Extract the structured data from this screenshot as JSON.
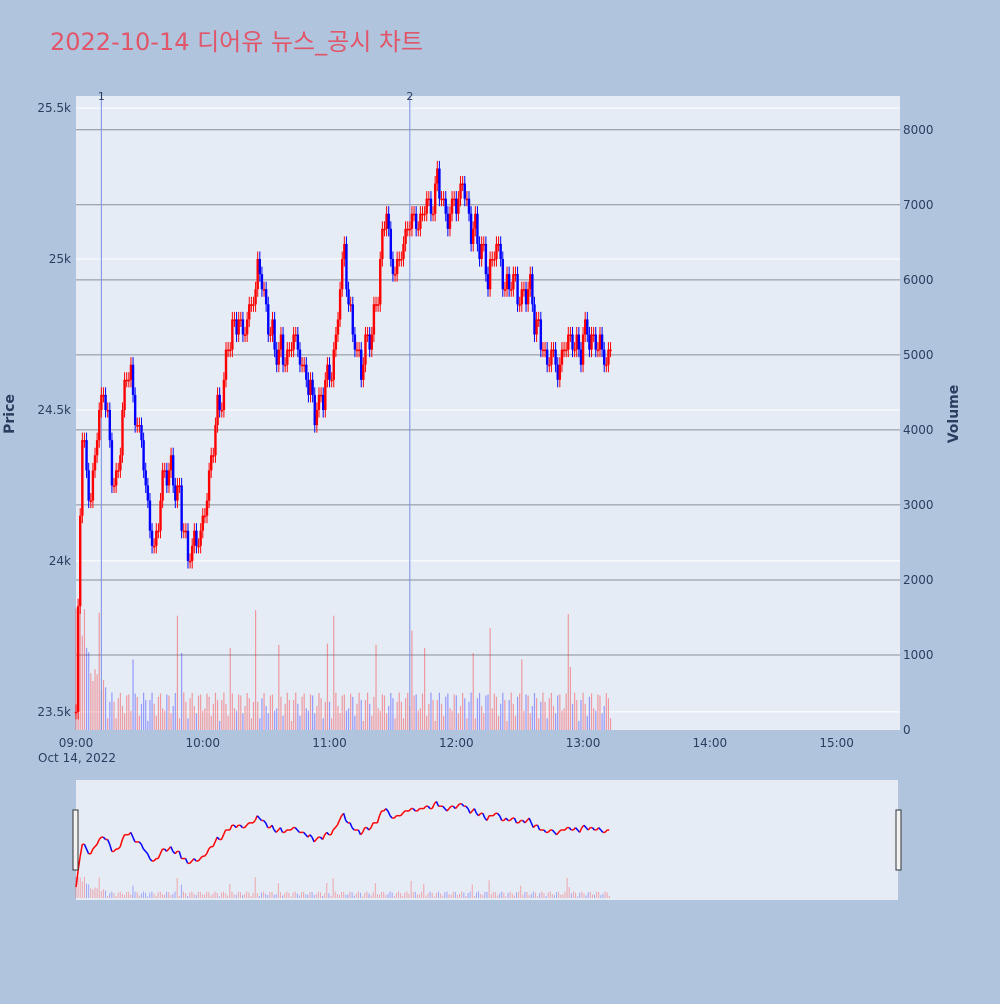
{
  "page": {
    "title": "2022-10-14 디어유 뉴스_공시 차트",
    "title_color": "#e0566a",
    "background": "#b0c4de",
    "plot_background": "#e5ecf6"
  },
  "chart_data": {
    "type": "candlestick",
    "title": "2022-10-14 디어유 뉴스_공시 차트",
    "date_label": "Oct 14, 2022",
    "x_ticks": [
      "09:00",
      "10:00",
      "11:00",
      "12:00",
      "13:00",
      "14:00",
      "15:00"
    ],
    "x_range": [
      "09:00",
      "15:30"
    ],
    "price_axis": {
      "label": "Price",
      "ticks": [
        23500,
        24000,
        24500,
        25000,
        25500
      ],
      "tick_labels": [
        "23.5k",
        "24k",
        "24.5k",
        "25k",
        "25.5k"
      ],
      "range": [
        23440,
        25540
      ]
    },
    "volume_axis": {
      "label": "Volume",
      "ticks": [
        0,
        1000,
        2000,
        3000,
        4000,
        5000,
        6000,
        7000,
        8000
      ],
      "range": [
        0,
        8450
      ]
    },
    "colors": {
      "up": "#ff0000",
      "down": "#0000ff"
    },
    "price_path": [
      [
        "09:00",
        23500
      ],
      [
        "09:01",
        23850
      ],
      [
        "09:02",
        24200
      ],
      [
        "09:03",
        24400
      ],
      [
        "09:05",
        24300
      ],
      [
        "09:07",
        24200
      ],
      [
        "09:09",
        24350
      ],
      [
        "09:11",
        24500
      ],
      [
        "09:13",
        24550
      ],
      [
        "09:15",
        24450
      ],
      [
        "09:17",
        24300
      ],
      [
        "09:19",
        24250
      ],
      [
        "09:21",
        24400
      ],
      [
        "09:23",
        24550
      ],
      [
        "09:25",
        24650
      ],
      [
        "09:27",
        24550
      ],
      [
        "09:29",
        24450
      ],
      [
        "09:31",
        24400
      ],
      [
        "09:33",
        24250
      ],
      [
        "09:35",
        24100
      ],
      [
        "09:37",
        24050
      ],
      [
        "09:39",
        24150
      ],
      [
        "09:41",
        24250
      ],
      [
        "09:43",
        24300
      ],
      [
        "09:45",
        24300
      ],
      [
        "09:47",
        24250
      ],
      [
        "09:49",
        24200
      ],
      [
        "09:51",
        24100
      ],
      [
        "09:53",
        24000
      ],
      [
        "09:55",
        24050
      ],
      [
        "09:57",
        24050
      ],
      [
        "09:59",
        24100
      ],
      [
        "10:01",
        24150
      ],
      [
        "10:03",
        24250
      ],
      [
        "10:05",
        24400
      ],
      [
        "10:07",
        24500
      ],
      [
        "10:09",
        24550
      ],
      [
        "10:11",
        24650
      ],
      [
        "10:13",
        24750
      ],
      [
        "10:15",
        24800
      ],
      [
        "10:17",
        24800
      ],
      [
        "10:19",
        24750
      ],
      [
        "10:21",
        24800
      ],
      [
        "10:23",
        24850
      ],
      [
        "10:25",
        24900
      ],
      [
        "10:27",
        25000
      ],
      [
        "10:29",
        24850
      ],
      [
        "10:31",
        24800
      ],
      [
        "10:33",
        24750
      ],
      [
        "10:35",
        24700
      ],
      [
        "10:37",
        24700
      ],
      [
        "10:39",
        24650
      ],
      [
        "10:41",
        24700
      ],
      [
        "10:43",
        24750
      ],
      [
        "10:45",
        24700
      ],
      [
        "10:47",
        24650
      ],
      [
        "10:49",
        24600
      ],
      [
        "10:51",
        24550
      ],
      [
        "10:53",
        24500
      ],
      [
        "10:55",
        24500
      ],
      [
        "10:57",
        24550
      ],
      [
        "10:59",
        24600
      ],
      [
        "11:01",
        24650
      ],
      [
        "11:03",
        24750
      ],
      [
        "11:05",
        24900
      ],
      [
        "11:07",
        25050
      ],
      [
        "11:09",
        24850
      ],
      [
        "11:11",
        24750
      ],
      [
        "11:13",
        24700
      ],
      [
        "11:15",
        24650
      ],
      [
        "11:17",
        24700
      ],
      [
        "11:19",
        24750
      ],
      [
        "11:21",
        24800
      ],
      [
        "11:23",
        24900
      ],
      [
        "11:25",
        25050
      ],
      [
        "11:27",
        25150
      ],
      [
        "11:29",
        25000
      ],
      [
        "11:31",
        24950
      ],
      [
        "11:33",
        25000
      ],
      [
        "11:35",
        25050
      ],
      [
        "11:37",
        25100
      ],
      [
        "11:39",
        25150
      ],
      [
        "11:41",
        25150
      ],
      [
        "11:43",
        25100
      ],
      [
        "11:45",
        25200
      ],
      [
        "11:47",
        25150
      ],
      [
        "11:49",
        25200
      ],
      [
        "11:51",
        25250
      ],
      [
        "11:53",
        25200
      ],
      [
        "11:55",
        25150
      ],
      [
        "11:57",
        25150
      ],
      [
        "11:59",
        25200
      ],
      [
        "12:01",
        25200
      ],
      [
        "12:03",
        25250
      ],
      [
        "12:05",
        25150
      ],
      [
        "12:07",
        25100
      ],
      [
        "12:09",
        25100
      ],
      [
        "12:11",
        25050
      ],
      [
        "12:13",
        25000
      ],
      [
        "12:15",
        24950
      ],
      [
        "12:17",
        25000
      ],
      [
        "12:19",
        25050
      ],
      [
        "12:21",
        25000
      ],
      [
        "12:23",
        24900
      ],
      [
        "12:25",
        24900
      ],
      [
        "12:27",
        24950
      ],
      [
        "12:29",
        24900
      ],
      [
        "12:31",
        24850
      ],
      [
        "12:33",
        24900
      ],
      [
        "12:35",
        24900
      ],
      [
        "12:37",
        24800
      ],
      [
        "12:39",
        24750
      ],
      [
        "12:41",
        24700
      ],
      [
        "12:43",
        24650
      ],
      [
        "12:45",
        24700
      ],
      [
        "12:47",
        24650
      ],
      [
        "12:49",
        24650
      ],
      [
        "12:51",
        24700
      ],
      [
        "12:53",
        24700
      ],
      [
        "12:55",
        24750
      ],
      [
        "12:57",
        24700
      ],
      [
        "12:59",
        24700
      ],
      [
        "13:01",
        24750
      ],
      [
        "13:03",
        24750
      ],
      [
        "13:05",
        24750
      ],
      [
        "13:07",
        24700
      ],
      [
        "13:09",
        24700
      ],
      [
        "13:11",
        24650
      ],
      [
        "13:13",
        24700
      ]
    ],
    "volume_bars": "synthetic per-minute volumes derived in script",
    "annotations": [
      {
        "label": "1",
        "time": "09:12"
      },
      {
        "label": "2",
        "time": "11:38"
      }
    ],
    "navigator": {
      "type": "range-slider",
      "range": [
        "09:00",
        "15:30"
      ]
    }
  }
}
